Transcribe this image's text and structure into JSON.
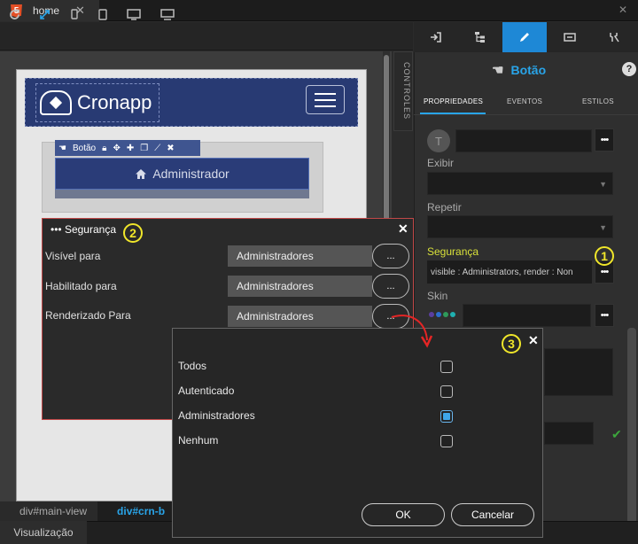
{
  "tabbar": {
    "file_badge": "5",
    "file_tab_label": "home",
    "file_tab_close": "✕",
    "window_close": "✕"
  },
  "toolbar": {
    "icons": [
      "refresh-icon",
      "expand-icon",
      "mobile-icon",
      "tablet-icon",
      "desktop-icon",
      "monitor-icon"
    ]
  },
  "canvas": {
    "logo_text": "Cronapp",
    "selection_toolbar_label": "Botão",
    "button_text": "Administrador",
    "controles_label": "CONTROLES"
  },
  "right_panel": {
    "component_title": "Botão",
    "help_label": "?",
    "subtabs": [
      "PROPRIEDADES",
      "EVENTOS",
      "ESTILOS"
    ],
    "avatar_letter": "T",
    "exibir_label": "Exibir",
    "repetir_label": "Repetir",
    "seguranca_label": "Segurança",
    "seguranca_value": "visible : Administrators, render : Non",
    "skin_label": "Skin",
    "dots_label": "•••",
    "swatch_colors": [
      "#5a3fa0",
      "#2c6fd0",
      "#2e9a5a",
      "#1fb0b0"
    ],
    "accent_color": "#1e88d6",
    "highlight_color": "#d8e03a"
  },
  "security_dialog": {
    "title": "Segurança",
    "title_dots": "•••",
    "close_label": "✕",
    "rows": [
      {
        "label": "Visível para",
        "value": "Administradores",
        "button": "..."
      },
      {
        "label": "Habilitado para",
        "value": "Administradores",
        "button": "..."
      },
      {
        "label": "Renderizado Para",
        "value": "Administradores",
        "button": "..."
      }
    ]
  },
  "roles_dialog": {
    "close_label": "✕",
    "options": [
      {
        "label": "Todos",
        "checked": false
      },
      {
        "label": "Autenticado",
        "checked": false
      },
      {
        "label": "Administradores",
        "checked": true
      },
      {
        "label": "Nenhum",
        "checked": false
      }
    ],
    "ok_label": "OK",
    "cancel_label": "Cancelar"
  },
  "annotations": {
    "step1": "1",
    "step2": "2",
    "step3": "3",
    "color": "#f0e62a"
  },
  "breadcrumbs": [
    "div#main-view",
    "div#crn-b"
  ],
  "statusbar": {
    "tab_label": "Visualização"
  }
}
